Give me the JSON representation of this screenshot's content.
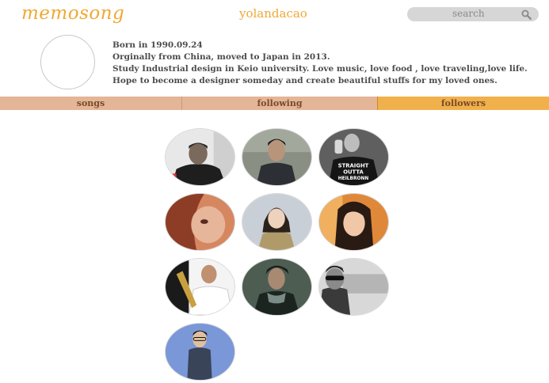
{
  "header": {
    "logo": "memosong",
    "username": "yolandacao",
    "search_placeholder": "search"
  },
  "profile": {
    "bio": [
      "Born in 1990.09.24",
      "Orginally from China, moved to Japan in 2013.",
      "Study Industrial design in Keio university. Love music, love food , love traveling,love life.",
      "Hope to become a designer someday and create beautiful stuffs for my loved ones."
    ]
  },
  "tabs": [
    {
      "label": "songs",
      "active": false
    },
    {
      "label": "following",
      "active": false
    },
    {
      "label": "followers",
      "active": true
    }
  ],
  "followers": [
    {
      "icon": "follower-avatar-1",
      "shirt_text": ""
    },
    {
      "icon": "follower-avatar-2",
      "shirt_text": ""
    },
    {
      "icon": "follower-avatar-3",
      "shirt_text": [
        "STRAIGHT",
        "OUTTA",
        "HEILBRONN"
      ]
    },
    {
      "icon": "follower-avatar-4",
      "shirt_text": ""
    },
    {
      "icon": "follower-avatar-5",
      "shirt_text": ""
    },
    {
      "icon": "follower-avatar-6",
      "shirt_text": ""
    },
    {
      "icon": "follower-avatar-7",
      "shirt_text": ""
    },
    {
      "icon": "follower-avatar-8",
      "shirt_text": ""
    },
    {
      "icon": "follower-avatar-9",
      "shirt_text": ""
    },
    {
      "icon": "follower-avatar-10",
      "shirt_text": ""
    }
  ],
  "colors": {
    "accent": "#f0a834",
    "tab_inactive": "#e4b596",
    "tab_active": "#f0b14c"
  }
}
